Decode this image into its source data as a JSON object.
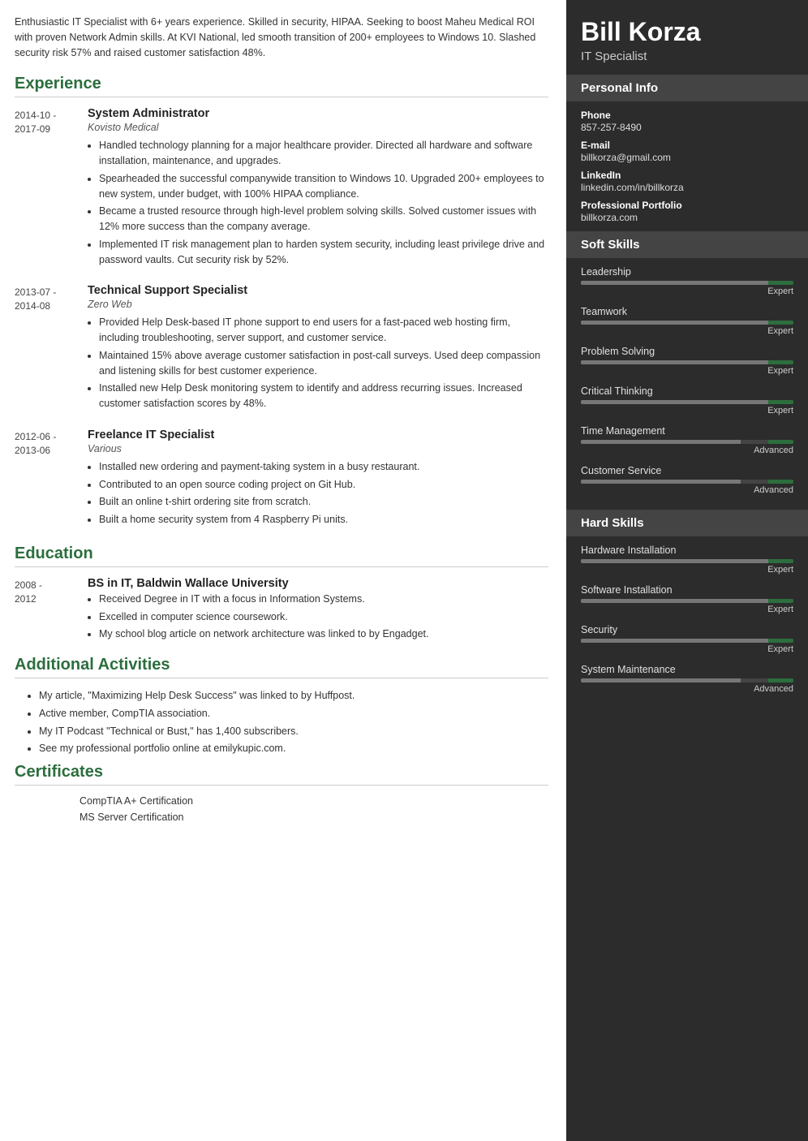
{
  "summary": "Enthusiastic IT Specialist with 6+ years experience. Skilled in security, HIPAA. Seeking to boost Maheu Medical ROI with proven Network Admin skills. At KVI National, led smooth transition of 200+ employees to Windows 10. Slashed security risk 57% and raised customer satisfaction 48%.",
  "sections": {
    "experience_title": "Experience",
    "education_title": "Education",
    "activities_title": "Additional Activities",
    "certificates_title": "Certificates"
  },
  "experience": [
    {
      "dates": "2014-10 -\n2017-09",
      "title": "System Administrator",
      "company": "Kovisto Medical",
      "bullets": [
        "Handled technology planning for a major healthcare provider. Directed all hardware and software installation, maintenance, and upgrades.",
        "Spearheaded the successful companywide transition to Windows 10. Upgraded 200+ employees to new system, under budget, with 100% HIPAA compliance.",
        "Became a trusted resource through high-level problem solving skills. Solved customer issues with 12% more success than the company average.",
        "Implemented IT risk management plan to harden system security, including least privilege drive and password vaults. Cut security risk by 52%."
      ]
    },
    {
      "dates": "2013-07 -\n2014-08",
      "title": "Technical Support Specialist",
      "company": "Zero Web",
      "bullets": [
        "Provided Help Desk-based IT phone support to end users for a fast-paced web hosting firm, including troubleshooting, server support, and customer service.",
        "Maintained 15% above average customer satisfaction in post-call surveys. Used deep compassion and listening skills for best customer experience.",
        "Installed new Help Desk monitoring system to identify and address recurring issues. Increased customer satisfaction scores by 48%."
      ]
    },
    {
      "dates": "2012-06 -\n2013-06",
      "title": "Freelance IT Specialist",
      "company": "Various",
      "bullets": [
        "Installed new ordering and payment-taking system in a busy restaurant.",
        "Contributed to an open source coding project on Git Hub.",
        "Built an online t-shirt ordering site from scratch.",
        "Built a home security system from 4 Raspberry Pi units."
      ]
    }
  ],
  "education": [
    {
      "dates": "2008 -\n2012",
      "title": "BS in IT, Baldwin Wallace University",
      "bullets": [
        "Received Degree in IT with a focus in Information Systems.",
        "Excelled in computer science coursework.",
        "My school blog article on network architecture was linked to by Engadget."
      ]
    }
  ],
  "activities": [
    "My article, \"Maximizing Help Desk Success\" was linked to by Huffpost.",
    "Active member, CompTIA association.",
    "My IT Podcast \"Technical or Bust,\" has 1,400 subscribers.",
    "See my professional portfolio online at emilykupic.com."
  ],
  "certificates": [
    "CompTIA A+ Certification",
    "MS Server Certification"
  ],
  "right": {
    "name": "Bill Korza",
    "title": "IT Specialist",
    "personal_info_title": "Personal Info",
    "phone_label": "Phone",
    "phone": "857-257-8490",
    "email_label": "E-mail",
    "email": "billkorza@gmail.com",
    "linkedin_label": "LinkedIn",
    "linkedin": "linkedin.com/in/billkorza",
    "portfolio_label": "Professional Portfolio",
    "portfolio": "billkorza.com",
    "soft_skills_title": "Soft Skills",
    "soft_skills": [
      {
        "name": "Leadership",
        "level": "Expert",
        "pct": 95
      },
      {
        "name": "Teamwork",
        "level": "Expert",
        "pct": 95
      },
      {
        "name": "Problem Solving",
        "level": "Expert",
        "pct": 95
      },
      {
        "name": "Critical Thinking",
        "level": "Expert",
        "pct": 95
      },
      {
        "name": "Time Management",
        "level": "Advanced",
        "pct": 75
      },
      {
        "name": "Customer Service",
        "level": "Advanced",
        "pct": 75
      }
    ],
    "hard_skills_title": "Hard Skills",
    "hard_skills": [
      {
        "name": "Hardware Installation",
        "level": "Expert",
        "pct": 95
      },
      {
        "name": "Software Installation",
        "level": "Expert",
        "pct": 95
      },
      {
        "name": "Security",
        "level": "Expert",
        "pct": 95
      },
      {
        "name": "System Maintenance",
        "level": "Advanced",
        "pct": 75
      }
    ]
  }
}
